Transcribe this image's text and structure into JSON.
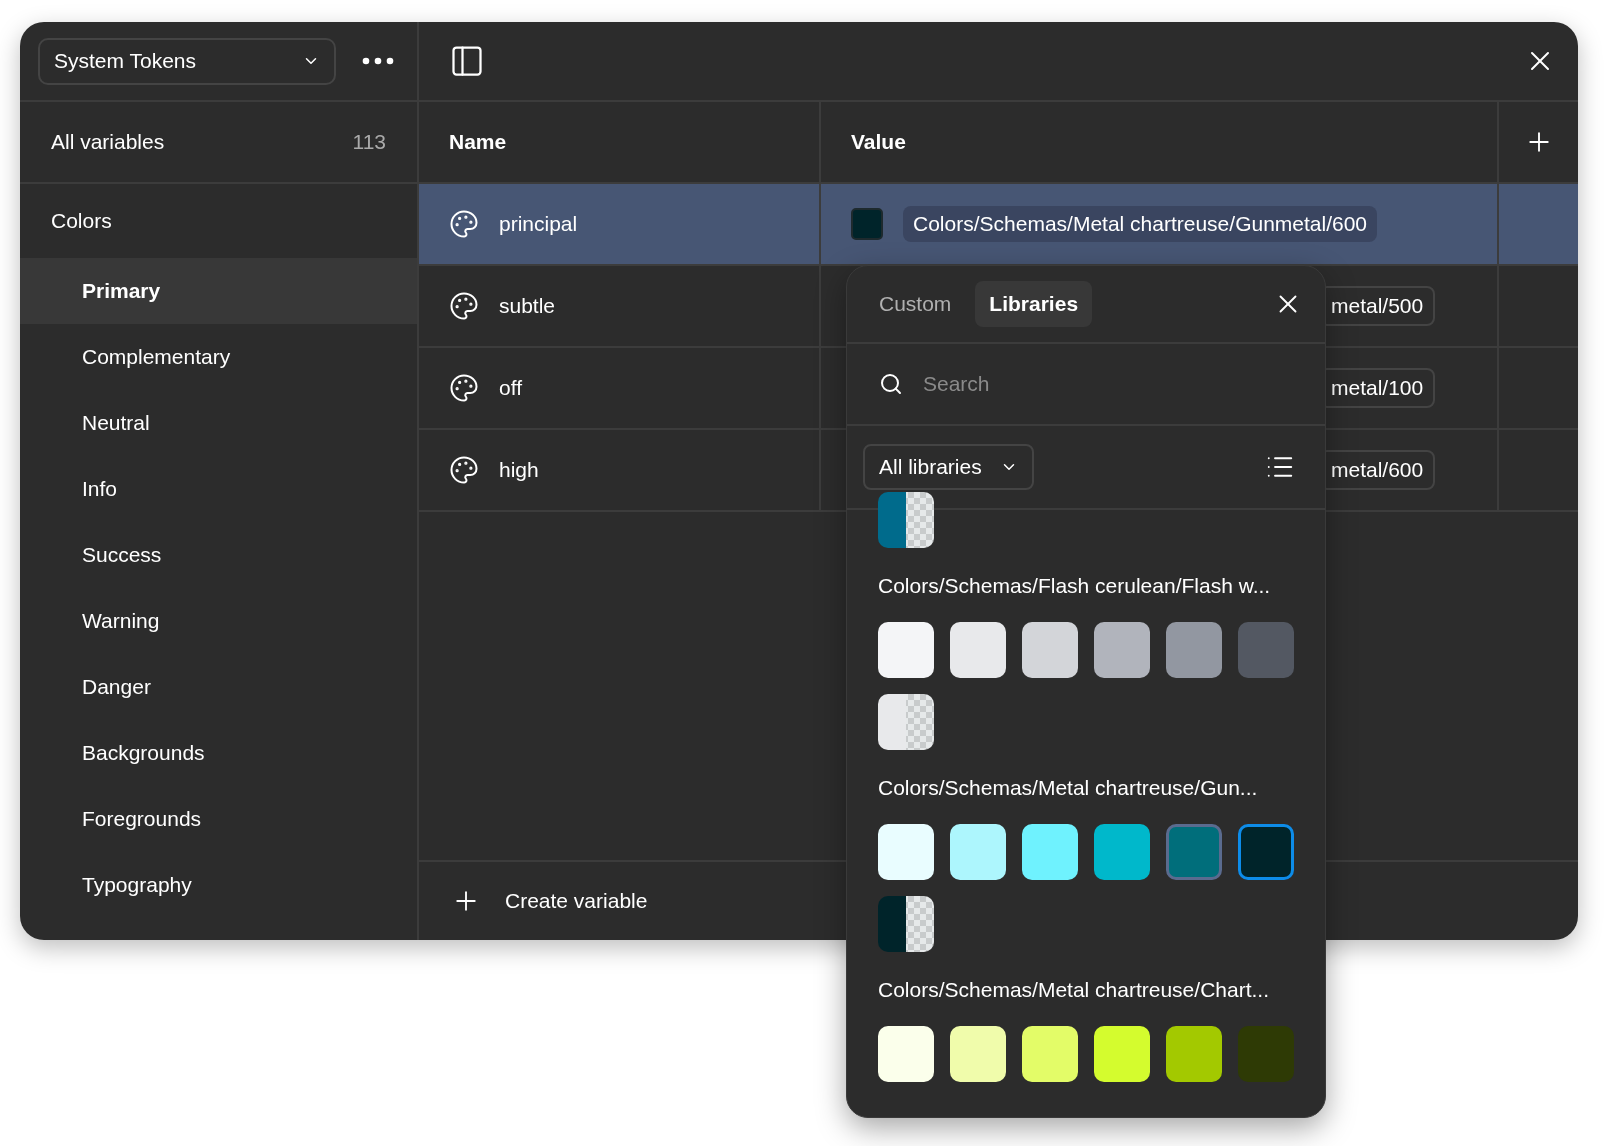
{
  "sidebar": {
    "collection": "System Tokens",
    "all_variables": {
      "label": "All variables",
      "count": "113"
    },
    "group": "Colors",
    "items": [
      {
        "label": "Primary",
        "selected": true
      },
      {
        "label": "Complementary",
        "selected": false
      },
      {
        "label": "Neutral",
        "selected": false
      },
      {
        "label": "Info",
        "selected": false
      },
      {
        "label": "Success",
        "selected": false
      },
      {
        "label": "Warning",
        "selected": false
      },
      {
        "label": "Danger",
        "selected": false
      },
      {
        "label": "Backgrounds",
        "selected": false
      },
      {
        "label": "Foregrounds",
        "selected": false
      },
      {
        "label": "Typography",
        "selected": false
      }
    ]
  },
  "table": {
    "columns": [
      "Name",
      "Value"
    ],
    "rows": [
      {
        "name": "principal",
        "selected": true,
        "color": "#00242a",
        "value": "Colors/Schemas/Metal chartreuse/Gunmetal/600",
        "covered": false
      },
      {
        "name": "subtle",
        "selected": false,
        "value": "metal/500",
        "covered": true
      },
      {
        "name": "off",
        "selected": false,
        "value": "metal/100",
        "covered": true
      },
      {
        "name": "high",
        "selected": false,
        "value": "metal/600",
        "covered": true
      }
    ]
  },
  "create_label": "Create variable",
  "picker": {
    "tabs": [
      {
        "label": "Custom",
        "selected": false
      },
      {
        "label": "Libraries",
        "selected": true
      }
    ],
    "search": {
      "placeholder": "Search"
    },
    "filter": "All libraries",
    "groups": [
      {
        "swatches": [
          {
            "color": "#006b8c",
            "kind": "transparent",
            "selected": false,
            "hovered": false
          }
        ]
      },
      {
        "label": "Colors/Schemas/Flash cerulean/Flash w...",
        "swatches": [
          {
            "color": "#f4f5f7",
            "kind": "solid",
            "selected": false,
            "hovered": false
          },
          {
            "color": "#e8e9eb",
            "kind": "solid",
            "selected": false,
            "hovered": false
          },
          {
            "color": "#d3d5d9",
            "kind": "solid",
            "selected": false,
            "hovered": false
          },
          {
            "color": "#b1b4bc",
            "kind": "solid",
            "selected": false,
            "hovered": false
          },
          {
            "color": "#9297a1",
            "kind": "solid",
            "selected": false,
            "hovered": false
          },
          {
            "color": "#535862",
            "kind": "solid",
            "selected": false,
            "hovered": false
          },
          {
            "color": "#e8e9eb",
            "kind": "transparent",
            "selected": false,
            "hovered": false
          }
        ]
      },
      {
        "label": "Colors/Schemas/Metal chartreuse/Gun...",
        "swatches": [
          {
            "color": "#e9fdff",
            "kind": "solid",
            "selected": false,
            "hovered": false
          },
          {
            "color": "#adf6fd",
            "kind": "solid",
            "selected": false,
            "hovered": false
          },
          {
            "color": "#6ff2fe",
            "kind": "solid",
            "selected": false,
            "hovered": false
          },
          {
            "color": "#00b8cb",
            "kind": "solid",
            "selected": false,
            "hovered": false
          },
          {
            "color": "#006e7b",
            "kind": "solid",
            "selected": false,
            "hovered": true
          },
          {
            "color": "#00242a",
            "kind": "solid",
            "selected": true,
            "hovered": false
          },
          {
            "color": "#00242a",
            "kind": "transparent",
            "selected": false,
            "hovered": false
          }
        ]
      },
      {
        "label": "Colors/Schemas/Metal chartreuse/Chart...",
        "swatches": [
          {
            "color": "#fbffeb",
            "kind": "solid",
            "selected": false,
            "hovered": false
          },
          {
            "color": "#f0fcab",
            "kind": "solid",
            "selected": false,
            "hovered": false
          },
          {
            "color": "#e3fc68",
            "kind": "solid",
            "selected": false,
            "hovered": false
          },
          {
            "color": "#d4fc2e",
            "kind": "solid",
            "selected": false,
            "hovered": false
          },
          {
            "color": "#a3c900",
            "kind": "solid",
            "selected": false,
            "hovered": false
          },
          {
            "color": "#2e3a05",
            "kind": "solid",
            "selected": false,
            "hovered": false
          }
        ]
      }
    ]
  }
}
